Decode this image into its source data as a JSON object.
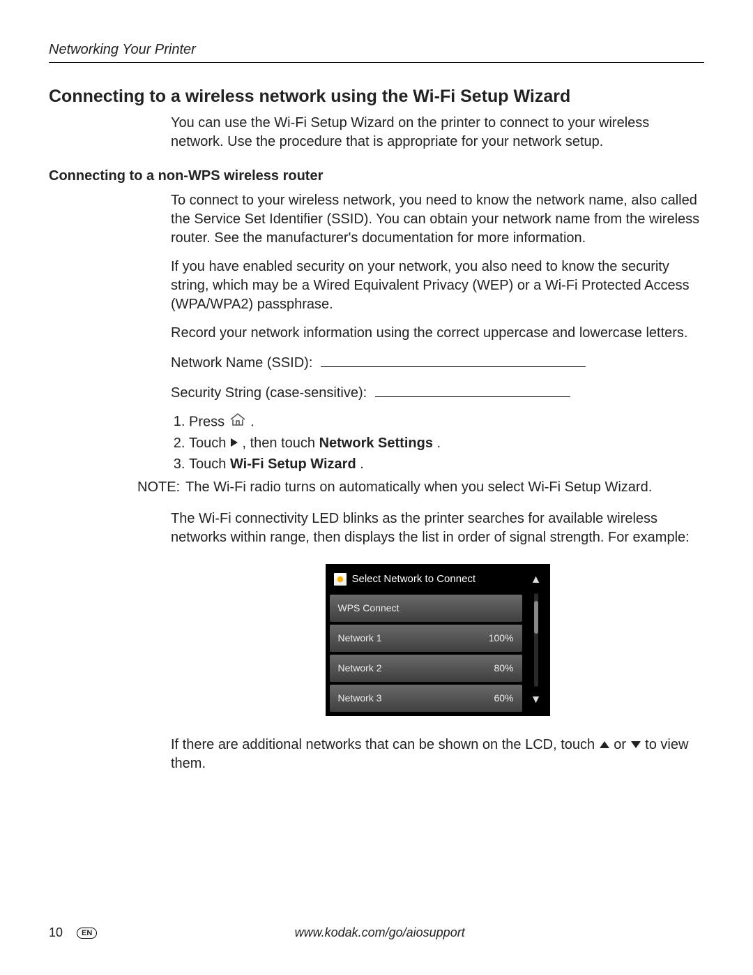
{
  "running_head": "Networking Your Printer",
  "h1": "Connecting to a wireless network using the Wi-Fi Setup Wizard",
  "intro": "You can use the Wi-Fi Setup Wizard on the printer to connect to your wireless network. Use the procedure that is appropriate for your network setup.",
  "h2": "Connecting to a non-WPS wireless router",
  "p1": "To connect to your wireless network, you need to know the network name, also called the Service Set Identifier (SSID). You can obtain your network name from the wireless router. See the manufacturer's documentation for more information.",
  "p2": "If you have enabled security on your network, you also need to know the security string, which may be a Wired Equivalent Privacy (WEP) or a Wi-Fi Protected Access (WPA/WPA2) passphrase.",
  "p3": "Record your network information using the correct uppercase and lowercase letters.",
  "field1_label": "Network Name (SSID):",
  "field2_label": "Security String (case-sensitive):",
  "steps": {
    "s1_a": "Press ",
    "s1_b": ".",
    "s2_a": "Touch ",
    "s2_b": " , then touch ",
    "s2_bold": "Network Settings",
    "s2_c": ".",
    "s3_a": "Touch ",
    "s3_bold": "Wi-Fi Setup Wizard",
    "s3_b": "."
  },
  "note_label": "NOTE:",
  "note_text": "The Wi-Fi radio turns on automatically when you select Wi-Fi Setup Wizard.",
  "p4": "The Wi-Fi connectivity LED blinks as the printer searches for available wireless networks within range, then displays the list in order of signal strength. For example:",
  "lcd": {
    "title": "Select Network to Connect",
    "rows": [
      {
        "name": "WPS Connect",
        "signal": ""
      },
      {
        "name": "Network 1",
        "signal": "100%"
      },
      {
        "name": "Network 2",
        "signal": "80%"
      },
      {
        "name": "Network 3",
        "signal": "60%"
      }
    ]
  },
  "p5_a": "If there are additional networks that can be shown on the LCD, touch ",
  "p5_b": " or ",
  "p5_c": " to view them.",
  "footer": {
    "page": "10",
    "lang": "EN",
    "url": "www.kodak.com/go/aiosupport"
  }
}
